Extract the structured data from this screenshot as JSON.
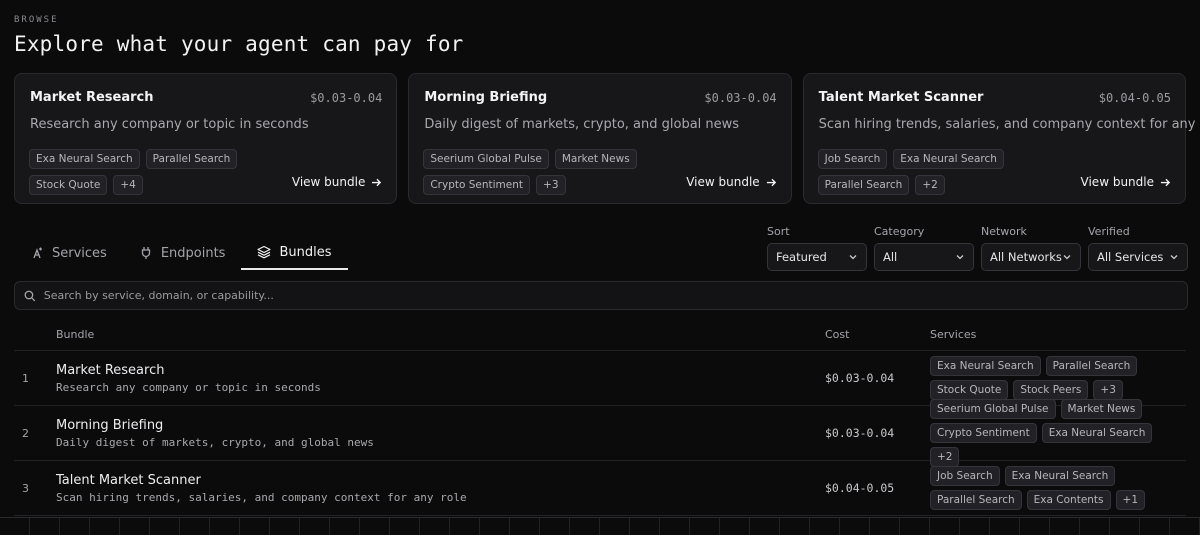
{
  "header": {
    "eyebrow": "BROWSE",
    "title": "Explore what your agent can pay for"
  },
  "featured": [
    {
      "name": "Market Research",
      "cost": "$0.03-0.04",
      "desc": "Research any company or topic in seconds",
      "tags": [
        "Exa Neural Search",
        "Parallel Search",
        "Stock Quote",
        "+4"
      ],
      "link": "View bundle"
    },
    {
      "name": "Morning Briefing",
      "cost": "$0.03-0.04",
      "desc": "Daily digest of markets, crypto, and global news",
      "tags": [
        "Seerium Global Pulse",
        "Market News",
        "Crypto Sentiment",
        "+3"
      ],
      "link": "View bundle"
    },
    {
      "name": "Talent Market Scanner",
      "cost": "$0.04-0.05",
      "desc": "Scan hiring trends, salaries, and company context for any role",
      "tags": [
        "Job Search",
        "Exa Neural Search",
        "Parallel Search",
        "+2"
      ],
      "link": "View bundle"
    }
  ],
  "tabs": [
    {
      "label": "Services",
      "icon": "sparkle-icon",
      "active": false
    },
    {
      "label": "Endpoints",
      "icon": "plug-icon",
      "active": false
    },
    {
      "label": "Bundles",
      "icon": "layers-icon",
      "active": true
    }
  ],
  "filters": [
    {
      "label": "Sort",
      "value": "Featured"
    },
    {
      "label": "Category",
      "value": "All"
    },
    {
      "label": "Network",
      "value": "All Networks"
    },
    {
      "label": "Verified",
      "value": "All Services"
    }
  ],
  "search": {
    "placeholder": "Search by service, domain, or capability..."
  },
  "table": {
    "headers": {
      "bundle": "Bundle",
      "cost": "Cost",
      "services": "Services"
    },
    "rows": [
      {
        "num": "1",
        "name": "Market Research",
        "desc": "Research any company or topic in seconds",
        "cost": "$0.03-0.04",
        "services": [
          "Exa Neural Search",
          "Parallel Search",
          "Stock Quote",
          "Stock Peers",
          "+3"
        ]
      },
      {
        "num": "2",
        "name": "Morning Briefing",
        "desc": "Daily digest of markets, crypto, and global news",
        "cost": "$0.03-0.04",
        "services": [
          "Seerium Global Pulse",
          "Market News",
          "Crypto Sentiment",
          "Exa Neural Search",
          "+2"
        ]
      },
      {
        "num": "3",
        "name": "Talent Market Scanner",
        "desc": "Scan hiring trends, salaries, and company context for any role",
        "cost": "$0.04-0.05",
        "services": [
          "Job Search",
          "Exa Neural Search",
          "Parallel Search",
          "Exa Contents",
          "+1"
        ]
      }
    ]
  }
}
